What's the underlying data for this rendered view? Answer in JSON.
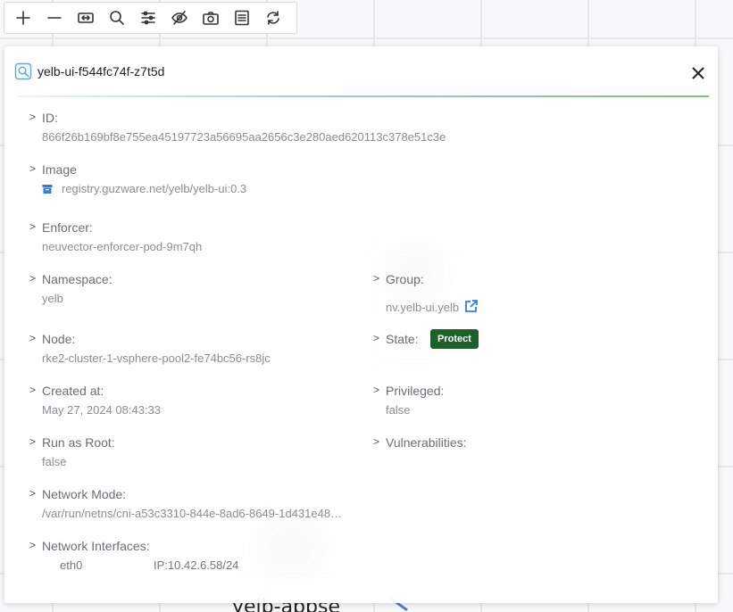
{
  "canvas": {
    "label": "yelb-appse"
  },
  "toolbar": {
    "buttons": [
      "zoom-in",
      "zoom-out",
      "fit-view",
      "search",
      "filter",
      "hide",
      "snapshot",
      "list",
      "refresh"
    ]
  },
  "panel": {
    "title": "yelb-ui-f544fc74f-z7t5d",
    "caret": ">",
    "id": {
      "label": "ID:",
      "value": "866f26b169bf8e755ea45197723a56695aa2656c3e280aed620113c378e51c3e"
    },
    "image": {
      "label": "Image",
      "value": "registry.guzware.net/yelb/yelb-ui:0.3"
    },
    "enforcer": {
      "label": "Enforcer:",
      "value": "neuvector-enforcer-pod-9m7qh"
    },
    "namespace": {
      "label": "Namespace:",
      "value": "yelb"
    },
    "group": {
      "label": "Group:",
      "value": "nv.yelb-ui.yelb"
    },
    "node": {
      "label": "Node:",
      "value": "rke2-cluster-1-vsphere-pool2-fe74bc56-rs8jc"
    },
    "state": {
      "label": "State:",
      "value": "Protect"
    },
    "created_at": {
      "label": "Created at:",
      "value": "May 27, 2024 08:43:33"
    },
    "privileged": {
      "label": "Privileged:",
      "value": "false"
    },
    "run_as_root": {
      "label": "Run as Root:",
      "value": "false"
    },
    "vulnerabilities": {
      "label": "Vulnerabilities:"
    },
    "network_mode": {
      "label": "Network Mode:",
      "value": "/var/run/netns/cni-a53c3310-844e-8ad6-8649-1d431e48…"
    },
    "network_interfaces": {
      "label": "Network Interfaces:",
      "name": "eth0",
      "ip": "IP:10.42.6.58/24"
    }
  },
  "colors": {
    "badge_protect": "#1f5f2c",
    "link": "#2f7de1",
    "image_icon": "#2f7de1"
  }
}
